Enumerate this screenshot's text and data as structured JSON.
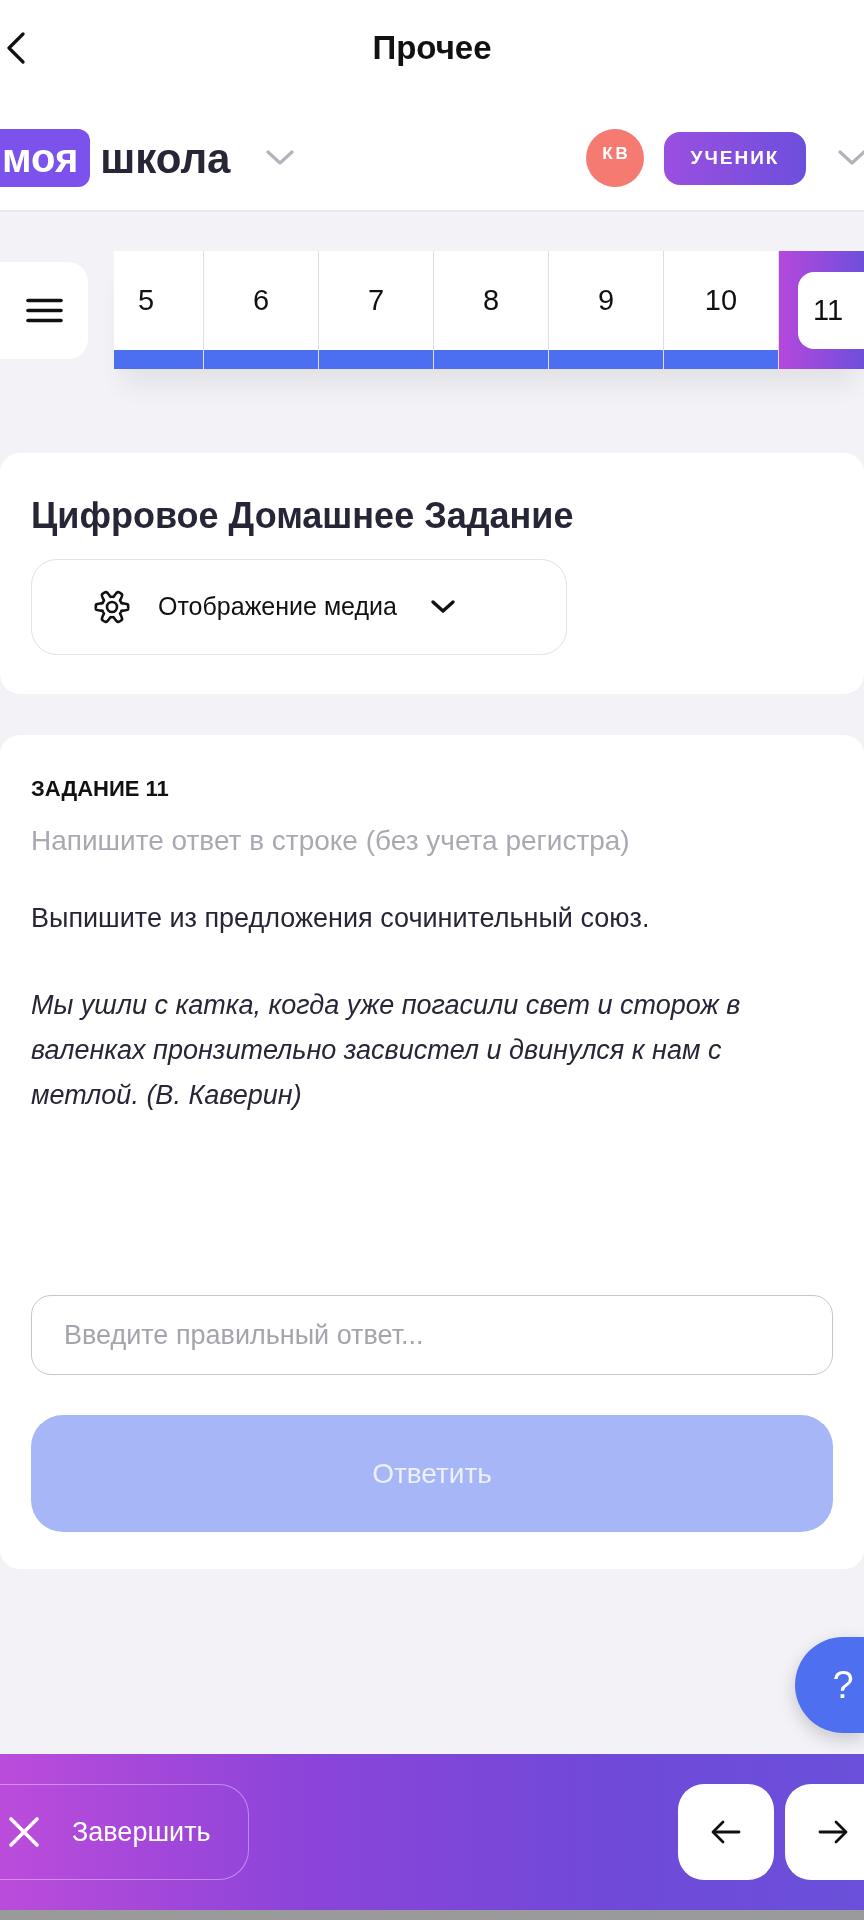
{
  "header": {
    "title": "Прочее"
  },
  "brand": {
    "logo_highlight": "моя",
    "logo_text": "школа",
    "avatar_initials": "КВ",
    "role": "УЧЕНИК"
  },
  "question_nav": {
    "items": [
      {
        "label": "5",
        "answered": true,
        "selected": false
      },
      {
        "label": "6",
        "answered": true,
        "selected": false
      },
      {
        "label": "7",
        "answered": true,
        "selected": false
      },
      {
        "label": "8",
        "answered": true,
        "selected": false
      },
      {
        "label": "9",
        "answered": true,
        "selected": false
      },
      {
        "label": "10",
        "answered": true,
        "selected": false
      },
      {
        "label": "11",
        "answered": false,
        "selected": true
      }
    ]
  },
  "homework": {
    "title": "Цифровое Домашнее Задание",
    "media_button": {
      "label": "Отображение медиа"
    }
  },
  "task": {
    "heading": "ЗАДАНИЕ 11",
    "hint": "Напишите ответ в строке (без учета регистра)",
    "instruction": "Выпишите из предложения сочинительный союз.",
    "sentence": "Мы ушли с катка, когда уже погасили свет и сторож в валенках пронзительно засвистел и двинулся к нам с метлой. (В. Каверин)",
    "answer_field": {
      "placeholder": "Введите правильный ответ..."
    },
    "submit": {
      "label": "Ответить",
      "disabled": true
    }
  },
  "help_button": {
    "label": "?"
  },
  "footer": {
    "finish_button": {
      "label": "Завершить"
    }
  }
}
